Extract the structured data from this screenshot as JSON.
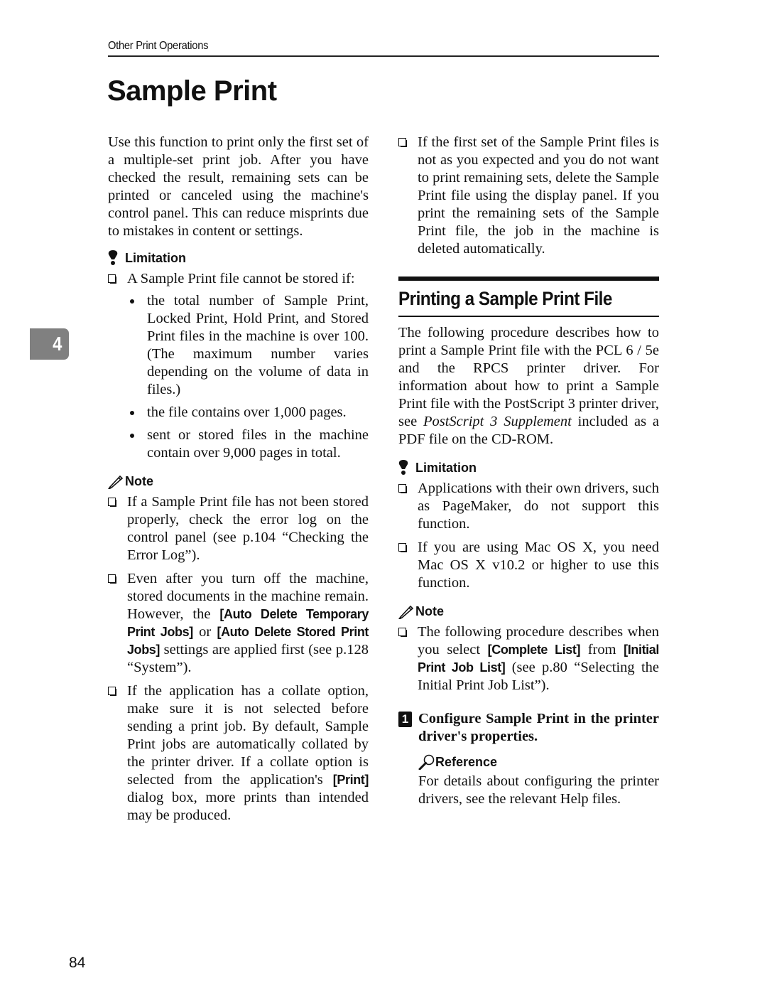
{
  "header": {
    "running_head": "Other Print Operations",
    "title": "Sample Print",
    "chapter_tab": "4",
    "page_number": "84"
  },
  "left_column": {
    "intro": "Use this function to print only the first set of a multiple-set print job. After you have checked the result, remaining sets can be printed or canceled using the machine's control panel. This can reduce misprints due to mistakes in content or settings.",
    "limitation": {
      "label": "Limitation",
      "icon": "exclamation-icon",
      "item": "A Sample Print file cannot be stored if:",
      "bullets": [
        "the total number of Sample Print, Locked Print, Hold Print, and Stored Print files in the machine is over 100. (The maximum number varies depending on the volume of data in files.)",
        "the file contains over 1,000 pages.",
        "sent or stored files in the machine contain over 9,000 pages in total."
      ]
    },
    "note": {
      "label": "Note",
      "icon": "pencil-icon",
      "items": [
        {
          "text": "If a Sample Print file has not been stored properly, check the error log on the control panel (see p.104 “Checking the Error Log”)."
        },
        {
          "pre": "Even after you turn off the machine, stored documents in the machine remain. However, the ",
          "key1": "[Auto Delete Temporary Print Jobs]",
          "mid": " or ",
          "key2": "[Auto Delete Stored Print Jobs]",
          "post": " settings are applied first (see p.128 “System”)."
        },
        {
          "pre": "If the application has a collate option, make sure it is not selected before sending a print job. By default, Sample Print jobs are automatically collated by the printer driver. If a collate option is selected from the application's ",
          "key1": "[Print]",
          "post": " dialog box, more prints than intended may be produced."
        }
      ]
    }
  },
  "right_column": {
    "top_item": "If the first set of the Sample Print files is not as you expected and you do not want to print remaining sets, delete the Sample Print file using the display panel. If you print the remaining sets of the Sample Print file, the job in the machine is deleted automatically.",
    "section_title": "Printing a Sample Print File",
    "section_intro": {
      "pre": "The following procedure describes how to print a Sample Print file with the PCL 6 / 5e and the RPCS printer driver. For information about how to print a Sample Print file with the PostScript 3 printer driver, see ",
      "italic": "PostScript 3 Supplement",
      "post": " included as a PDF file on the CD-ROM."
    },
    "limitation": {
      "label": "Limitation",
      "icon": "exclamation-icon",
      "items": [
        "Applications with their own drivers, such as PageMaker, do not support this function.",
        "If you are using Mac OS X, you need Mac OS X v10.2 or higher to use this function."
      ]
    },
    "note": {
      "label": "Note",
      "icon": "pencil-icon",
      "item": {
        "pre": "The following procedure describes when you select ",
        "key1": "[Complete List]",
        "mid": " from ",
        "key2": "[Initial Print Job List]",
        "post": " (see p.80 “Selecting the Initial Print Job List”)."
      }
    },
    "step": {
      "number": "1",
      "text": "Configure Sample Print in the printer driver's properties.",
      "reference": {
        "label": "Reference",
        "icon": "magnifier-icon",
        "text": "For details about configuring the printer drivers, see the relevant Help files."
      }
    }
  }
}
